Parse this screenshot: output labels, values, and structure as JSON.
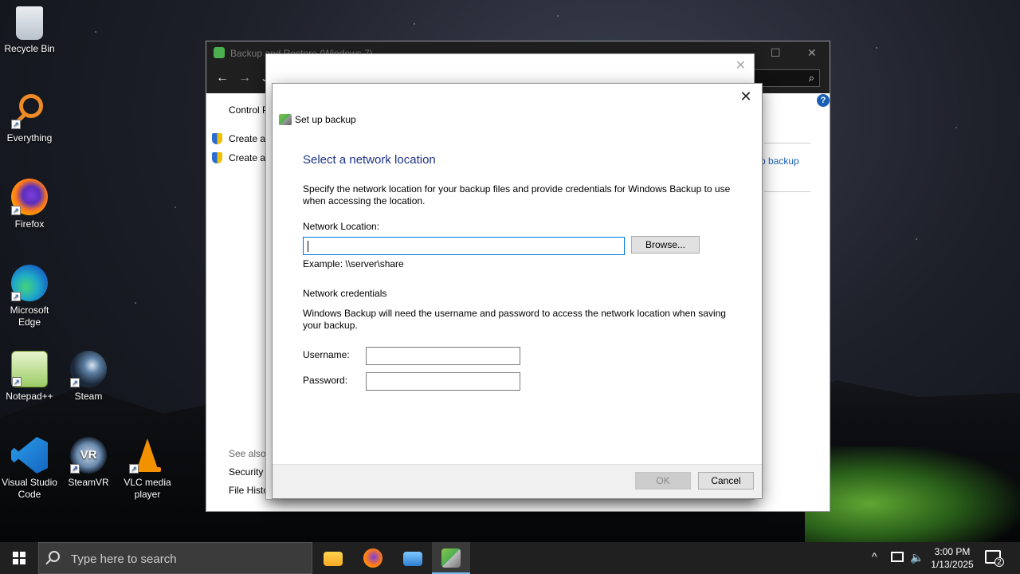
{
  "desktop": {
    "icons": [
      {
        "label": "Recycle Bin"
      },
      {
        "label": "Everything"
      },
      {
        "label": "Firefox"
      },
      {
        "label": "Microsoft Edge"
      },
      {
        "label": "Notepad++"
      },
      {
        "label": "Steam"
      },
      {
        "label": "Visual Studio Code"
      },
      {
        "label": "SteamVR"
      },
      {
        "label": "VLC media player"
      }
    ]
  },
  "background_window": {
    "title": "Backup and Restore (Windows 7)",
    "nav_back": "←",
    "nav_forward": "→",
    "nav_dropdown": "⌄",
    "search_icon": "search-icon",
    "breadcrumb": "Control P",
    "side_links": [
      "Create a",
      "Create a"
    ],
    "see_also": "See also",
    "see_also_links": [
      "Security",
      "File History"
    ],
    "right_link": "p backup",
    "help_label": "?"
  },
  "dialog": {
    "header": "Set up backup",
    "heading": "Select a network location",
    "description": "Specify the network location for your backup files and provide credentials for Windows Backup to use when accessing the location.",
    "network_location_label": "Network Location:",
    "network_location_value": "",
    "browse_label": "Browse...",
    "example": "Example: \\\\server\\share",
    "credentials_heading": "Network credentials",
    "credentials_description": "Windows Backup will need the username and password to access the network location when saving your backup.",
    "username_label": "Username:",
    "username_value": "",
    "password_label": "Password:",
    "password_value": "",
    "ok_label": "OK",
    "cancel_label": "Cancel",
    "close_glyph": "✕"
  },
  "taskbar": {
    "search_placeholder": "Type here to search",
    "time": "3:00 PM",
    "date": "1/13/2025",
    "notification_count": "2",
    "tray_chevron": "^"
  },
  "colors": {
    "heading_blue": "#1e3287",
    "link_blue": "#1a5fb4",
    "focus_border": "#0078d7",
    "taskbar_bg": "#202020"
  }
}
